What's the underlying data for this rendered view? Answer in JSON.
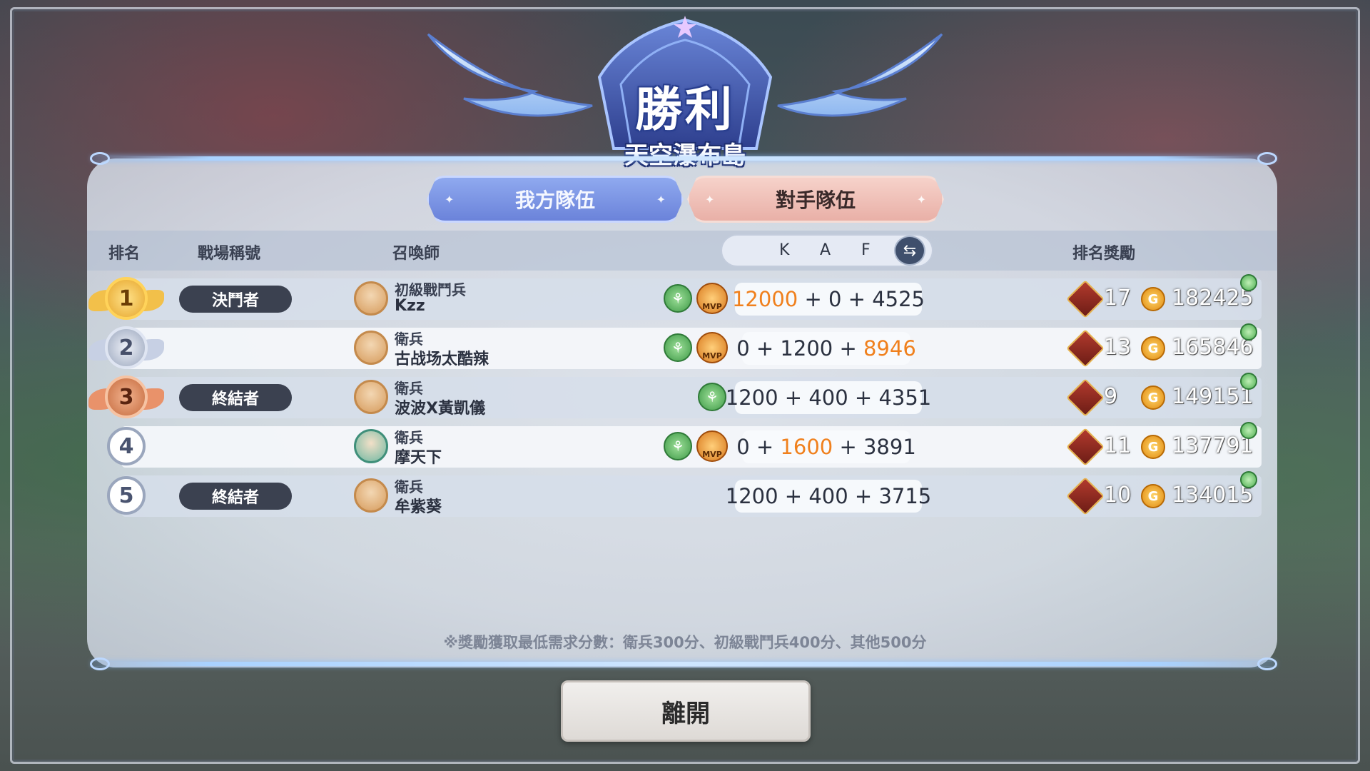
{
  "header": {
    "result": "勝利",
    "map_name": "天空瀑布島"
  },
  "tabs": {
    "ours": "我方隊伍",
    "theirs": "對手隊伍"
  },
  "columns": {
    "rank": "排名",
    "title": "戰場稱號",
    "summoner": "召喚師",
    "k": "K",
    "a": "A",
    "f": "F",
    "reward": "排名獎勵"
  },
  "rows": [
    {
      "rank": "1",
      "title": "決鬥者",
      "rank_title": "初級戰鬥兵",
      "name": "Kzz",
      "k": "12000",
      "a": "0",
      "f": "4525",
      "plus1": "+",
      "plus2": "+",
      "reward_count": "17",
      "coin_count": "182425",
      "mvp_label": "MVP"
    },
    {
      "rank": "2",
      "title": "",
      "rank_title": "衛兵",
      "name": "古战场太酷辣",
      "k": "0",
      "a": "1200",
      "f": "8946",
      "plus1": "+",
      "plus2": "+",
      "reward_count": "13",
      "coin_count": "165846",
      "mvp_label": "MVP"
    },
    {
      "rank": "3",
      "title": "終結者",
      "rank_title": "衛兵",
      "name": "波波X黃凱儀",
      "k": "1200",
      "a": "400",
      "f": "4351",
      "plus1": "+",
      "plus2": "+",
      "reward_count": "9",
      "coin_count": "149151",
      "mvp_label": ""
    },
    {
      "rank": "4",
      "title": "",
      "rank_title": "衛兵",
      "name": "摩天下",
      "k": "0",
      "a": "1600",
      "f": "3891",
      "plus1": "+",
      "plus2": "+",
      "reward_count": "11",
      "coin_count": "137791",
      "mvp_label": "MVP"
    },
    {
      "rank": "5",
      "title": "終結者",
      "rank_title": "衛兵",
      "name": "牟紫葵",
      "k": "1200",
      "a": "400",
      "f": "3715",
      "plus1": "+",
      "plus2": "+",
      "reward_count": "10",
      "coin_count": "134015",
      "mvp_label": ""
    }
  ],
  "note": "※獎勵獲取最低需求分數：衛兵300分、初級戰鬥兵400分、其他500分",
  "leave_button": "離開",
  "colors": {
    "highlight": "#f0801d",
    "ours_tab": "#7b93e2",
    "theirs_tab": "#efc2b9",
    "title_pill": "#3b4150"
  },
  "icons": {
    "swap": "swap-arrows-icon",
    "leaf": "leaf-badge-icon",
    "mvp": "mvp-medal-icon",
    "reward": "red-ticket-icon",
    "coin": "gold-coin-icon",
    "gift": "gift-icon"
  }
}
